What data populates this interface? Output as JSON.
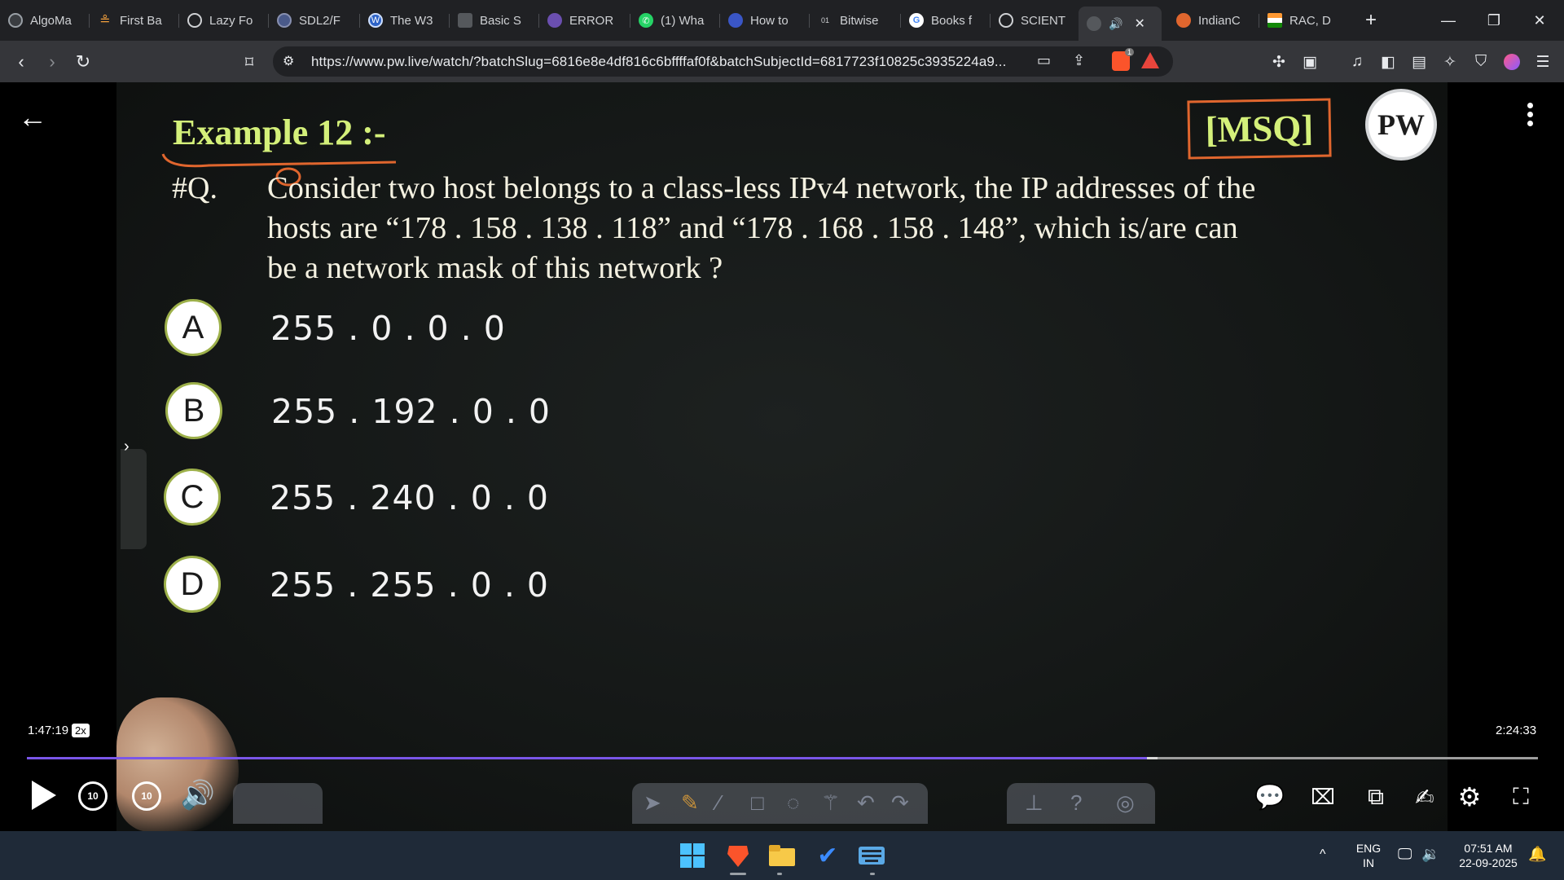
{
  "browser": {
    "tabs": [
      {
        "label": "AlgoMa",
        "icon": "algomaster-icon",
        "color": "#3a3d41"
      },
      {
        "label": "First Ba",
        "icon": "stack-icon",
        "color": "#f2a03d"
      },
      {
        "label": "Lazy Fo",
        "icon": "globe-icon",
        "color": "#555"
      },
      {
        "label": "SDL2/F",
        "icon": "sdl-icon",
        "color": "#4a5a8a"
      },
      {
        "label": "The W3",
        "icon": "w3-icon",
        "color": "#2d63c8"
      },
      {
        "label": "Basic S",
        "icon": "page-icon",
        "color": "#555"
      },
      {
        "label": "ERROR",
        "icon": "error-icon",
        "color": "#6b4fb0"
      },
      {
        "label": "(1) Wha",
        "icon": "whatsapp-icon",
        "color": "#25d366"
      },
      {
        "label": "How to",
        "icon": "shield-icon",
        "color": "#3a56c6"
      },
      {
        "label": "Bitwise",
        "icon": "bitwise-icon",
        "color": "#3a3d41"
      },
      {
        "label": "Books f",
        "icon": "google-icon",
        "color": "#ffffff"
      },
      {
        "label": "SCIENT",
        "icon": "globe-icon",
        "color": "#555"
      },
      {
        "label": "",
        "icon": "speaker-icon",
        "color": "#555"
      },
      {
        "label": "IndianC",
        "icon": "indian-icon",
        "color": "#e0662e"
      },
      {
        "label": "RAC, D",
        "icon": "flag-icon",
        "color": "#ff9933"
      }
    ],
    "url": "https://www.pw.live/watch/?batchSlug=6816e8e4df816c6bffffaf0f&batchSubjectId=6817723f10825c3935224a9...",
    "brave_badge": "1"
  },
  "slide": {
    "example_title": "Example 12 :-",
    "tag": "[MSQ]",
    "logo_text": "PW",
    "question_no": "#Q.",
    "question_lines": [
      "Consider two host belongs to a class-less IPv4 network, the IP addresses of the",
      "hosts are “178 . 158 . 138 . 118” and “178 . 168 . 158 . 148”, which is/are can",
      "be a network mask of this network ?"
    ],
    "options": [
      {
        "letter": "A",
        "value": "255 . 0 . 0 . 0"
      },
      {
        "letter": "B",
        "value": "255 . 192 . 0 . 0"
      },
      {
        "letter": "C",
        "value": "255 . 240 . 0 . 0"
      },
      {
        "letter": "D",
        "value": "255 . 255 . 0 . 0"
      }
    ]
  },
  "player": {
    "current_time": "1:47:19",
    "speed": "2x",
    "duration": "2:24:33",
    "progress_fraction": 0.7412,
    "buffered_fraction": 0.748,
    "rewind_label": "10",
    "forward_label": "10"
  },
  "taskbar": {
    "lang_top": "ENG",
    "lang_bottom": "IN",
    "time": "07:51 AM",
    "date": "22-09-2025"
  }
}
